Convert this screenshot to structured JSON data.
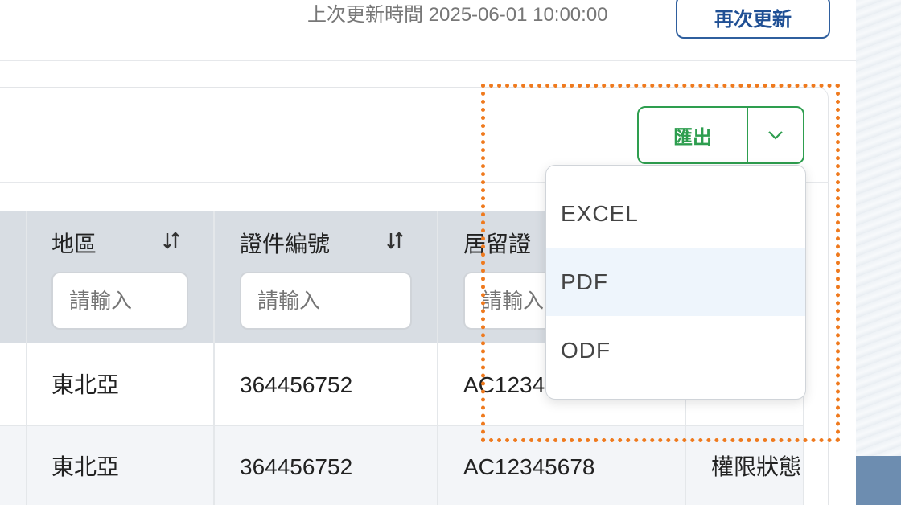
{
  "header": {
    "last_updated": "上次更新時間 2025-06-01 10:00:00",
    "refresh_label": "再次更新"
  },
  "toolbar": {
    "export_label": "匯出",
    "toggle_icon": "chevron-down-icon"
  },
  "export_menu": {
    "items": [
      "EXCEL",
      "PDF",
      "ODF"
    ],
    "highlighted_item": "PDF"
  },
  "table": {
    "columns": [
      {
        "label": "地區",
        "sortable": true,
        "filter_placeholder": "請輸入"
      },
      {
        "label": "證件編號",
        "sortable": true,
        "filter_placeholder": "請輸入"
      },
      {
        "label": "居留證",
        "sortable": true,
        "filter_placeholder": "請輸入"
      }
    ],
    "rows": [
      {
        "region": "東北亞",
        "id_number": "364456752",
        "residence_permit": "AC1234",
        "extra": ""
      },
      {
        "region": "東北亞",
        "id_number": "364456752",
        "residence_permit": "AC12345678",
        "extra": "權限狀態"
      }
    ]
  },
  "colors": {
    "accent_green": "#2e9e4f",
    "refresh_blue": "#1f4f94",
    "highlight_orange": "#ef7a1e",
    "header_bg": "#d8dde3"
  }
}
